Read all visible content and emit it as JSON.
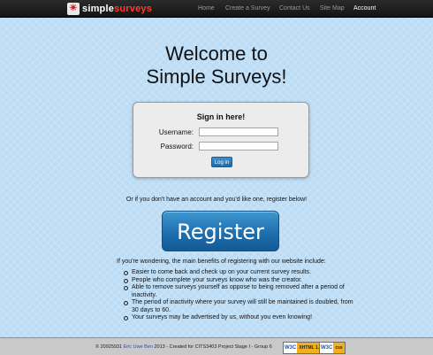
{
  "nav": {
    "brand": {
      "icon": "sun-logo-icon",
      "part1": "simple",
      "part2": "surveys"
    },
    "links": [
      {
        "label": "Home",
        "active": false
      },
      {
        "label": "Create a Survey",
        "active": false
      },
      {
        "label": "Contact Us",
        "active": false
      },
      {
        "label": "Site Map",
        "active": false
      },
      {
        "label": "Account",
        "active": true
      }
    ]
  },
  "welcome": {
    "line1": "Welcome to",
    "line2": "Simple Surveys!"
  },
  "login": {
    "title": "Sign in here!",
    "username_label": "Username:",
    "username_value": "",
    "password_label": "Password:",
    "password_value": "",
    "button_label": "Log in"
  },
  "register": {
    "prompt": "Or if you don't have an account and you'd like one, register below!",
    "button_label": "Register"
  },
  "benefits": {
    "intro": "If you're wondering, the main benefits of registering with our website include:",
    "items": [
      "Easier to come back and check up on your current survey results.",
      "People who complete your surveys know who was the creator.",
      "Able to remove surveys yourself as oppose to being removed after a period of inactivity.",
      "The period of inactivity where your survey will still be maintained is doubled, from 30 days to 60.",
      "Your surveys may be advertised by us, without you even knowing!"
    ]
  },
  "footer": {
    "prefix": "© 20925931",
    "link1": "Eric",
    "link2": "Uwe Ben",
    "suffix": "2013 - Created for CITS3403 Project Stage I - Group 6",
    "badges": [
      {
        "brand": "W3C",
        "tag": "XHTML 1.1"
      },
      {
        "brand": "W3C",
        "tag": "css"
      }
    ]
  },
  "colors": {
    "page_bg": "#bcdcf5",
    "navbar": "#1f1f1f",
    "button_blue": "#1f6fae"
  }
}
